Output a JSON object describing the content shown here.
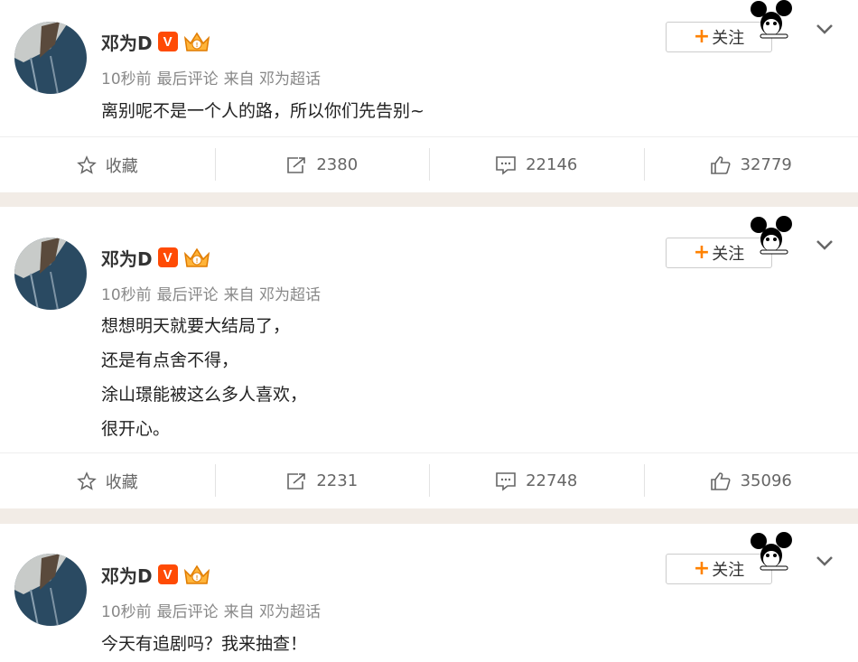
{
  "colors": {
    "accent": "#ff8200",
    "vip": "#ff4b05",
    "page_bg": "#f2ece6"
  },
  "posts": [
    {
      "author": "邓为D",
      "verified_badge": "V",
      "time": "10秒前",
      "sort": "最后评论",
      "source": "来自 邓为超话",
      "lines": [
        "离别呢不是一个人的路，所以你们先告别~"
      ],
      "follow_label": "关注",
      "actions": {
        "favorite": "收藏",
        "repost": "2380",
        "comments": "22146",
        "likes": "32779"
      }
    },
    {
      "author": "邓为D",
      "verified_badge": "V",
      "time": "10秒前",
      "sort": "最后评论",
      "source": "来自 邓为超话",
      "lines": [
        "想想明天就要大结局了，",
        "还是有点舍不得，",
        "涂山璟能被这么多人喜欢，",
        "很开心。"
      ],
      "follow_label": "关注",
      "actions": {
        "favorite": "收藏",
        "repost": "2231",
        "comments": "22748",
        "likes": "35096"
      }
    },
    {
      "author": "邓为D",
      "verified_badge": "V",
      "time": "10秒前",
      "sort": "最后评论",
      "source": "来自 邓为超话",
      "lines": [
        "今天有追剧吗？我来抽查！"
      ],
      "follow_label": "关注",
      "actions": {}
    }
  ],
  "icons": {
    "favorite": "star-icon",
    "repost": "share-icon",
    "comments": "comment-icon",
    "likes": "thumbs-up-icon",
    "more": "chevron-down-icon",
    "decoration": "mickey-icon",
    "vip": "crown-icon"
  }
}
